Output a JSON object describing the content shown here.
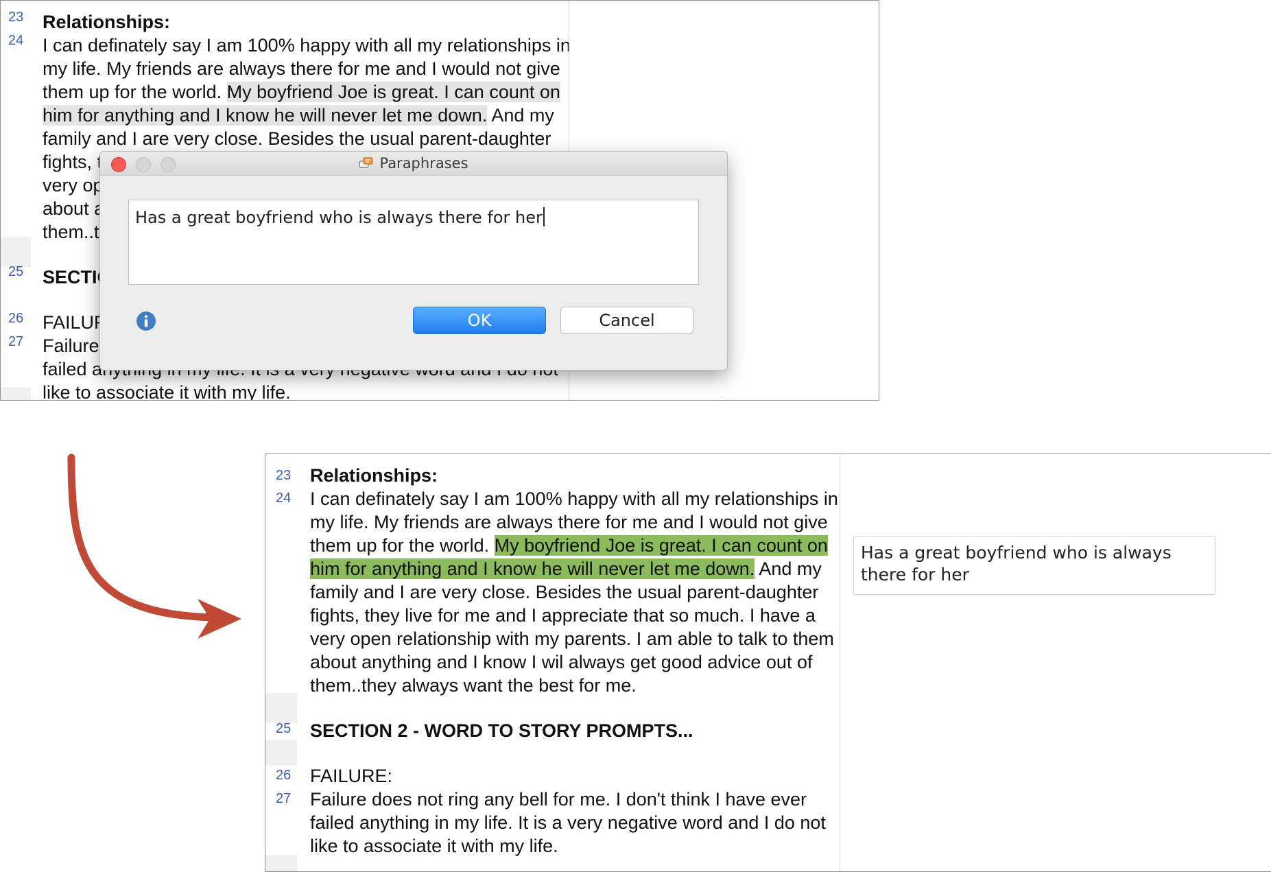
{
  "document": {
    "line_numbers": [
      "23",
      "24",
      "25",
      "26",
      "27"
    ],
    "heading": "Relationships:",
    "para1": {
      "l1": "I can definately say I am 100% happy with all my relationships in",
      "l2": "my life.  My friends are always there for me and I would not give",
      "l3_pre": "them up for the world.  ",
      "l3_quote": "My boyfriend Joe is great.  I can count on",
      "l4_quote": "him for anything and I know he will never let me down.",
      "l4_post": "  And my",
      "l5": "family and I are very close.  Besides the usual parent-daughter",
      "l6": "fights, they live for me and I appreciate that so much.  I have a",
      "l7": "very open relationship with my parents.  I am able to talk to them",
      "l8": "about anything and I know I wil always get good advice out of",
      "l9": "them..they always want the best for me."
    },
    "section_heading": "SECTION 2 - WORD TO STORY PROMPTS...",
    "failure_heading": "FAILURE:",
    "para2": {
      "l1": "Failure does not ring any bell for me.  I don't think I have ever",
      "l2": "failed anything in my life.  It is a very negative word and I do not",
      "l3": "like to associate it with my life."
    },
    "top_partial": {
      "l6": "fights, th",
      "l7": "very ope",
      "l8": "about ar",
      "l9": "them..th",
      "section": "SECTIO",
      "failure": "FAILUR",
      "p2l1": "Failure d",
      "p2l2": "failed anything in my life.  It is a very negative word and I do not"
    }
  },
  "dialog": {
    "title": "Paraphrases",
    "input_value": "Has a great boyfriend who is always there for her",
    "ok_label": "OK",
    "cancel_label": "Cancel"
  },
  "memo": {
    "l1": "Has a great boyfriend who is always",
    "l2": "there for her"
  },
  "colors": {
    "quote_highlight": "#8cbb5c",
    "selection_highlight": "#e3e3e3",
    "arrow": "#c04a35",
    "ok_button": "#1f7ef0",
    "line_number": "#3a5fb0"
  },
  "icons": [
    "close-button-icon",
    "minimize-button-icon",
    "zoom-button-icon",
    "paraphrase-icon",
    "info-icon",
    "arrow-icon"
  ]
}
